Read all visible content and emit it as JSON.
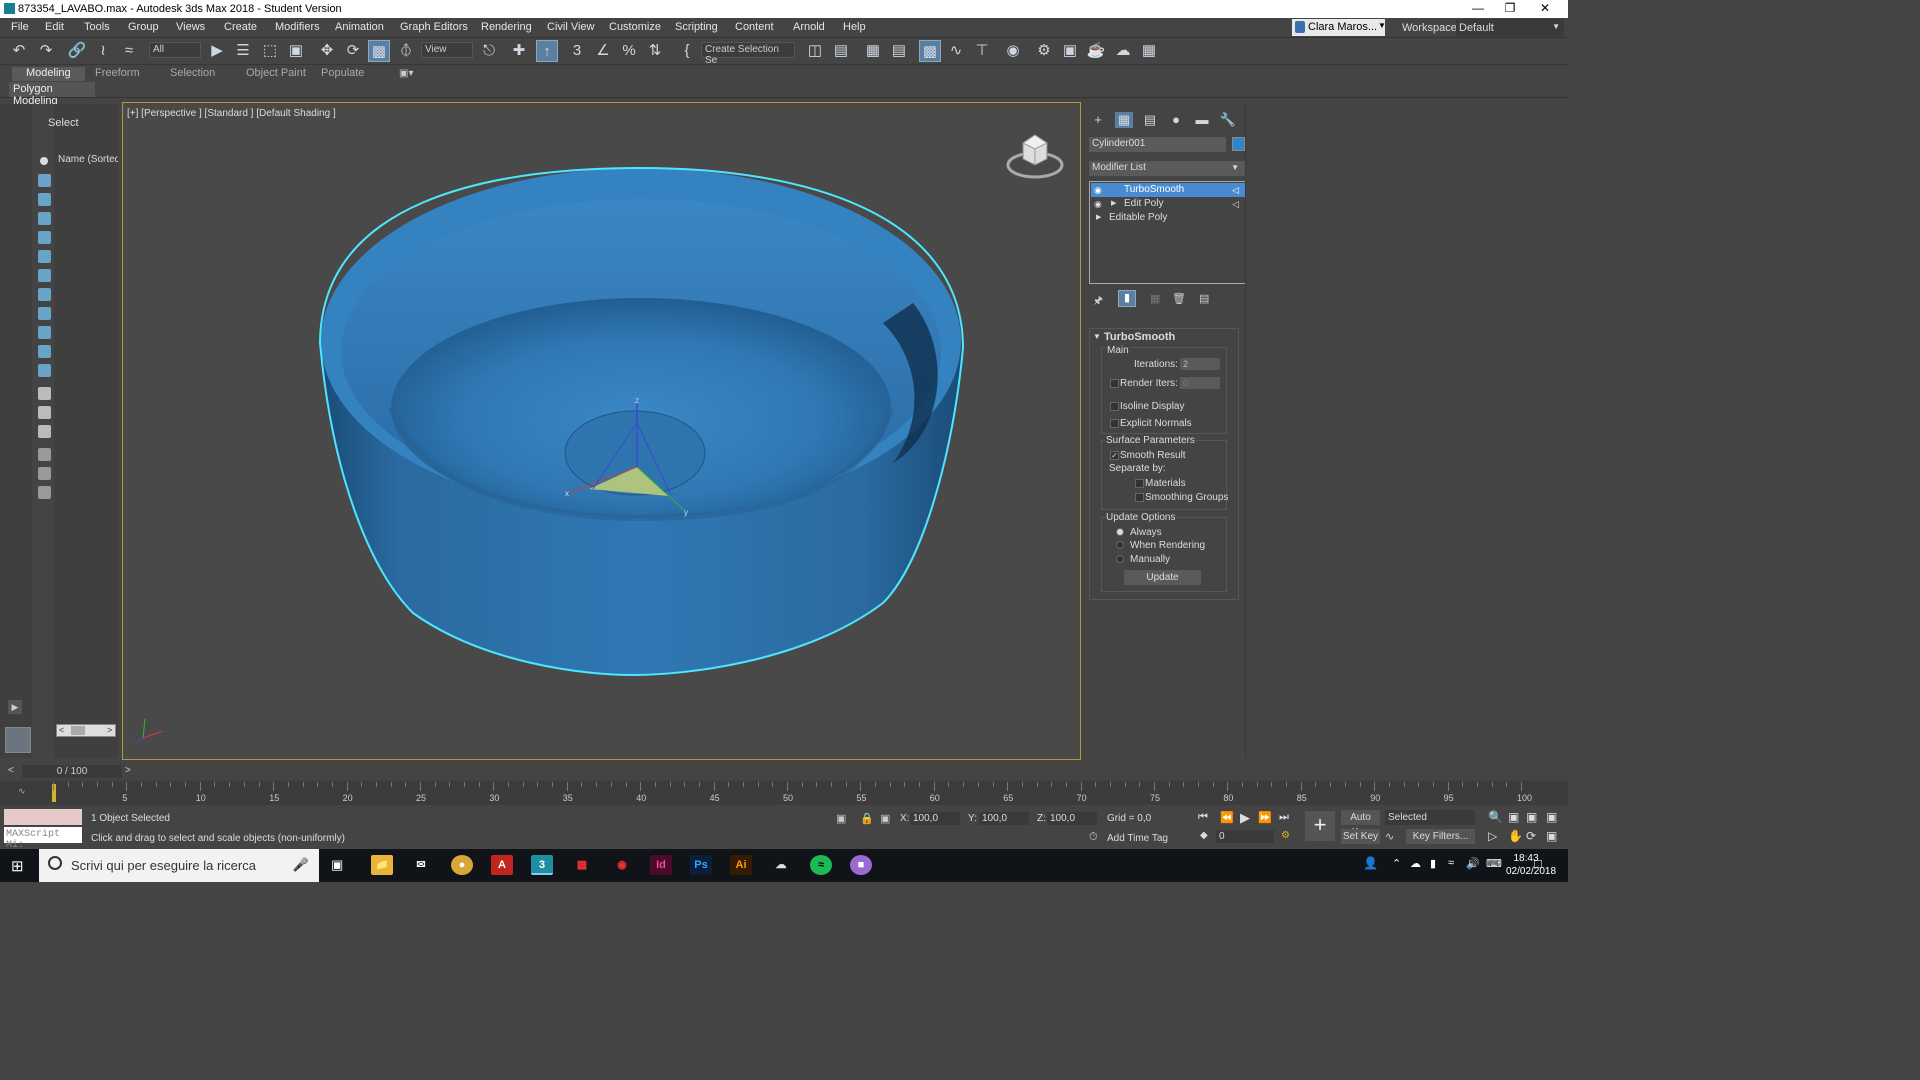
{
  "window": {
    "title": "873354_LAVABO.max - Autodesk 3ds Max 2018 - Student Version"
  },
  "menu": [
    "File",
    "Edit",
    "Tools",
    "Group",
    "Views",
    "Create",
    "Modifiers",
    "Animation",
    "Graph Editors",
    "Rendering",
    "Civil View",
    "Customize",
    "Scripting",
    "Content",
    "Arnold",
    "Help"
  ],
  "user": {
    "name": "Clara Maros...",
    "workspaces_label": "Workspaces:",
    "workspace": "Default"
  },
  "toolbar": {
    "filter": "All",
    "ref_coord": "View",
    "selection_set": "Create Selection Se"
  },
  "ribbon": {
    "tabs": [
      "Modeling",
      "Freeform",
      "Selection",
      "Object Paint",
      "Populate"
    ],
    "active": "Modeling",
    "panel": "Polygon Modeling"
  },
  "scene_explorer": {
    "select_label": "Select",
    "column": "Name (Sorted A"
  },
  "viewport": {
    "label": "[+] [Perspective ] [Standard ] [Default Shading ]"
  },
  "command_panel": {
    "object_name": "Cylinder001",
    "object_color": "#2e86c8",
    "modifier_list": "Modifier List",
    "stack": [
      "TurboSmooth",
      "Edit Poly",
      "Editable Poly"
    ],
    "rollout": {
      "title": "TurboSmooth",
      "main_label": "Main",
      "iterations_label": "Iterations:",
      "iterations": "2",
      "render_iters_label": "Render Iters:",
      "render_iters": "0",
      "isoline": "Isoline Display",
      "explicit_normals": "Explicit Normals",
      "surface_params": "Surface Parameters",
      "smooth_result": "Smooth Result",
      "separate_by": "Separate by:",
      "materials": "Materials",
      "smoothing_groups": "Smoothing Groups",
      "update_options": "Update Options",
      "always": "Always",
      "when_rendering": "When Rendering",
      "manually": "Manually",
      "update_btn": "Update"
    }
  },
  "timeline": {
    "frame": "0 / 100",
    "ticks": [
      "5",
      "10",
      "15",
      "20",
      "25",
      "30",
      "35",
      "40",
      "45",
      "50",
      "55",
      "60",
      "65",
      "70",
      "75",
      "80",
      "85",
      "90",
      "95",
      "100"
    ]
  },
  "status": {
    "objects_selected": "1 Object Selected",
    "hint": "Click and drag to select and scale objects (non-uniformly)",
    "maxscript": "MAXScript Mi:",
    "x_label": "X:",
    "x": "100,0",
    "y_label": "Y:",
    "y": "100,0",
    "z_label": "Z:",
    "z": "100,0",
    "grid": "Grid = 0,0",
    "add_time_tag": "Add Time Tag",
    "auto_key": "Auto Key",
    "set_key": "Set Key",
    "selected": "Selected",
    "key_filters": "Key Filters...",
    "frame_field": "0"
  },
  "taskbar": {
    "search": "Scrivi qui per eseguire la ricerca",
    "time": "18:43",
    "date": "02/02/2018"
  }
}
